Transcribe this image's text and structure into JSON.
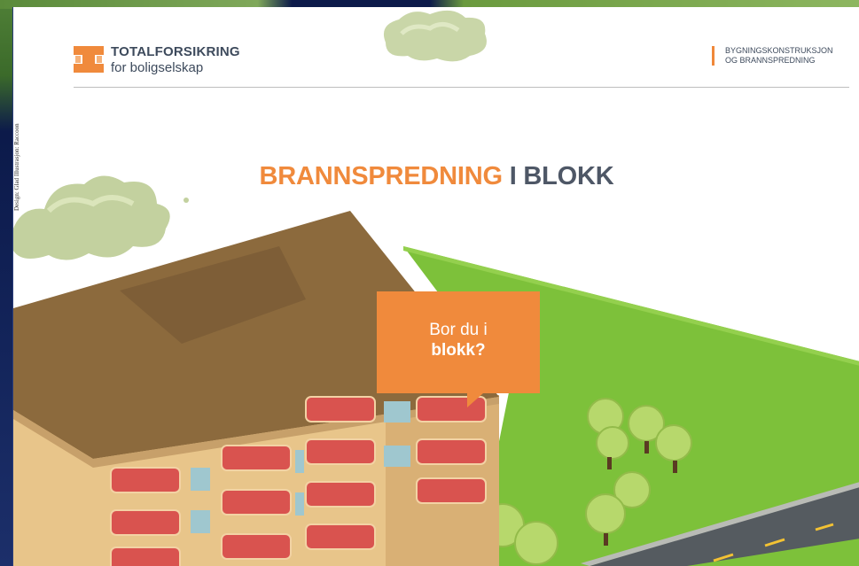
{
  "brand": {
    "name": "TOTALFORSIKRING",
    "subtitle": "for boligselskap",
    "accent_color": "#f08a3c",
    "text_color": "#3d4a5c"
  },
  "topic": {
    "line1": "BYGNINGSKONSTRUKSJON",
    "line2": "OG BRANNSPREDNING"
  },
  "credit": {
    "text": "Design: Glad  Illustrasjon: Raccoon"
  },
  "title": {
    "part1": "BRANNSPREDNING",
    "part2": "I BLOKK"
  },
  "cta_bubble": {
    "line1": "Bor du i",
    "line2": "blokk?"
  },
  "illustration": {
    "name": "apartment-block-illustration",
    "elements": [
      "cloud-icon",
      "apartment-building",
      "trees",
      "road"
    ]
  }
}
